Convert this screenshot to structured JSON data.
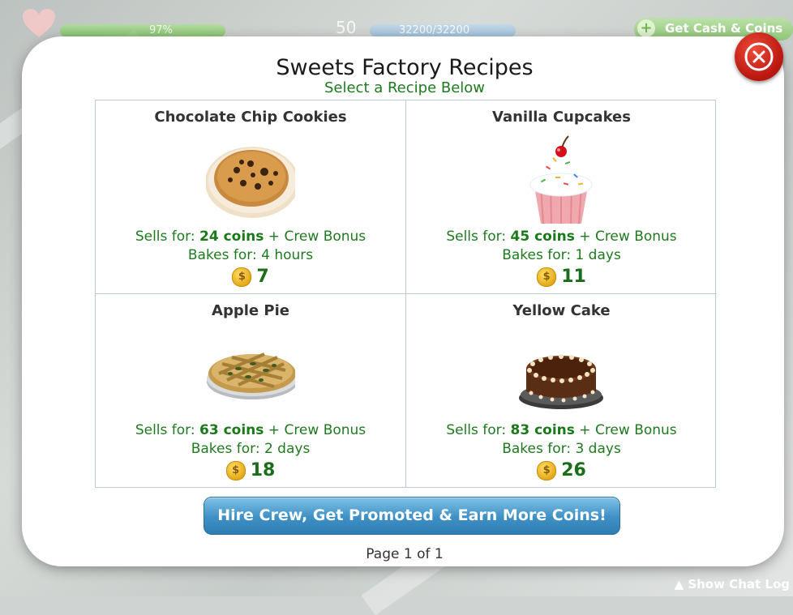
{
  "hud": {
    "health_percent_text": "97%",
    "health_fraction": 0.97,
    "level": "50",
    "xp_text": "32200/32200",
    "get_cash_label": "Get Cash & Coins",
    "show_chat_log_label": "▲ Show Chat Log"
  },
  "modal": {
    "title": "Sweets Factory Recipes",
    "subtitle": "Select a Recipe Below",
    "close_icon": "close-icon",
    "recipes": [
      {
        "name": "Chocolate Chip Cookies",
        "sells_prefix": "Sells for: ",
        "sells_value": "24 coins",
        "sells_suffix": " + Crew Bonus",
        "bakes": "Bakes for: 4 hours",
        "cost": "7",
        "image": "cookie-plate-icon"
      },
      {
        "name": "Vanilla Cupcakes",
        "sells_prefix": "Sells for: ",
        "sells_value": "45 coins",
        "sells_suffix": " + Crew Bonus",
        "bakes": "Bakes for: 1 days",
        "cost": "11",
        "image": "cupcake-icon"
      },
      {
        "name": "Apple Pie",
        "sells_prefix": "Sells for: ",
        "sells_value": "63 coins",
        "sells_suffix": " + Crew Bonus",
        "bakes": "Bakes for: 2 days",
        "cost": "18",
        "image": "pie-icon"
      },
      {
        "name": "Yellow Cake",
        "sells_prefix": "Sells for: ",
        "sells_value": "83 coins",
        "sells_suffix": " + Crew Bonus",
        "bakes": "Bakes for: 3 days",
        "cost": "26",
        "image": "chocolate-cake-icon"
      }
    ],
    "coin_symbol": "$",
    "hire_button_label": "Hire Crew, Get Promoted & Earn More Coins!",
    "page_indicator": "Page 1 of 1"
  },
  "colors": {
    "accent_green": "#1f7a1f",
    "button_blue": "#3e90c5",
    "close_red": "#c41f14"
  }
}
